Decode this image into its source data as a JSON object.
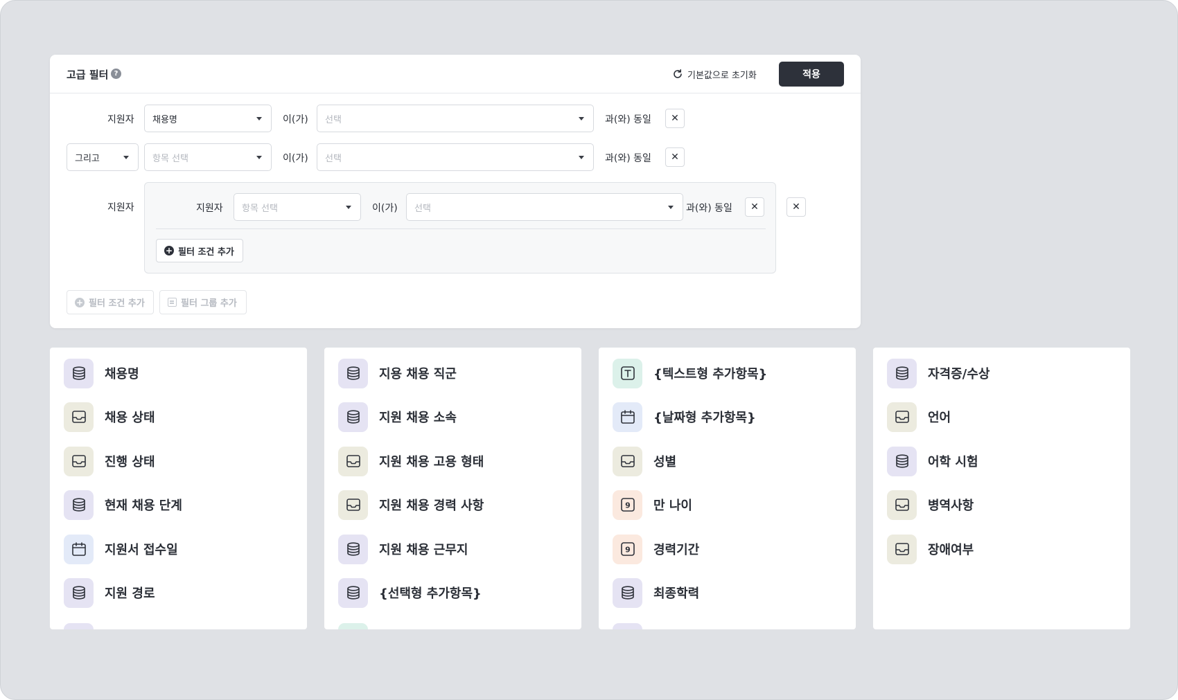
{
  "panel": {
    "title": "고급 필터",
    "help_icon": "question-circle-icon",
    "reset_label": "기본값으로 초기화",
    "apply_label": "적용"
  },
  "row1": {
    "subject_label": "지원자",
    "field_value": "채용명",
    "connector": "이(가)",
    "value_placeholder": "선택",
    "operator": "과(와) 동일"
  },
  "row2": {
    "logic_value": "그리고",
    "field_placeholder": "항목 선택",
    "connector": "이(가)",
    "value_placeholder": "선택",
    "operator": "과(와) 동일"
  },
  "group": {
    "outer_label": "지원자",
    "inner_label": "지원자",
    "field_placeholder": "항목 선택",
    "connector": "이(가)",
    "value_placeholder": "선택",
    "operator": "과(와) 동일",
    "add_condition_label": "필터 조건 추가"
  },
  "footer": {
    "add_condition_label": "필터 조건 추가",
    "add_group_label": "필터 그룹 추가"
  },
  "remove_icon": "close-icon",
  "columns": [
    {
      "items": [
        {
          "label": "채용명",
          "icon": "database-icon",
          "color": "purple"
        },
        {
          "label": "채용 상태",
          "icon": "inbox-icon",
          "color": "beige"
        },
        {
          "label": "진행 상태",
          "icon": "inbox-icon",
          "color": "beige"
        },
        {
          "label": "현재 채용 단계",
          "icon": "database-icon",
          "color": "purple"
        },
        {
          "label": "지원서 접수일",
          "icon": "calendar-icon",
          "color": "blue"
        },
        {
          "label": "지원 경로",
          "icon": "database-icon",
          "color": "purple"
        }
      ],
      "peek_color": "purple"
    },
    {
      "items": [
        {
          "label": "지용 채용 직군",
          "icon": "database-icon",
          "color": "purple"
        },
        {
          "label": "지원 채용 소속",
          "icon": "database-icon",
          "color": "purple"
        },
        {
          "label": "지원 채용 고용 형태",
          "icon": "inbox-icon",
          "color": "beige"
        },
        {
          "label": "지원 채용 경력 사항",
          "icon": "inbox-icon",
          "color": "beige"
        },
        {
          "label": "지원 채용 근무지",
          "icon": "database-icon",
          "color": "purple"
        },
        {
          "label": "{선택형 추가항목}",
          "icon": "database-icon",
          "color": "purple"
        }
      ],
      "peek_color": "teal"
    },
    {
      "items": [
        {
          "label": "{텍스트형 추가항목}",
          "icon": "text-icon",
          "color": "teal"
        },
        {
          "label": "{날짜형 추가항목}",
          "icon": "calendar-icon",
          "color": "blue"
        },
        {
          "label": "성별",
          "icon": "inbox-icon",
          "color": "beige"
        },
        {
          "label": "만 나이",
          "icon": "number-icon",
          "color": "peach"
        },
        {
          "label": "경력기간",
          "icon": "number-icon",
          "color": "peach"
        },
        {
          "label": "최종학력",
          "icon": "database-icon",
          "color": "purple"
        }
      ],
      "peek_color": "purple"
    },
    {
      "items": [
        {
          "label": "자격증/수상",
          "icon": "database-icon",
          "color": "purple"
        },
        {
          "label": "언어",
          "icon": "inbox-icon",
          "color": "beige"
        },
        {
          "label": "어학 시험",
          "icon": "database-icon",
          "color": "purple"
        },
        {
          "label": "병역사항",
          "icon": "inbox-icon",
          "color": "beige"
        },
        {
          "label": "장애여부",
          "icon": "inbox-icon",
          "color": "beige"
        }
      ],
      "peek_color": null
    }
  ]
}
